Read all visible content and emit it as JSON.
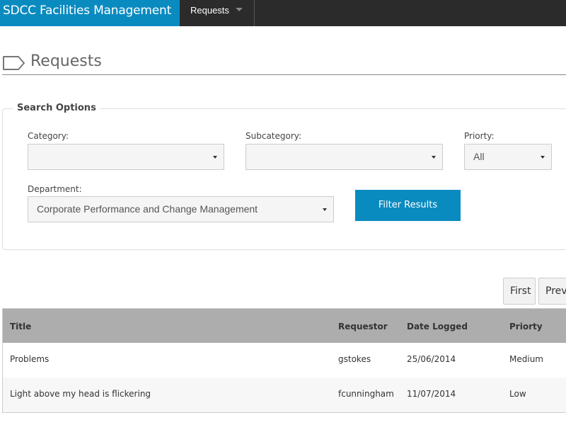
{
  "header": {
    "brand": "SDCC Facilities Management",
    "nav": [
      {
        "label": "Requests",
        "icon": "caret-down-icon"
      }
    ]
  },
  "page": {
    "title": "Requests",
    "title_icon": "tag-icon"
  },
  "search": {
    "legend": "Search Options",
    "category": {
      "label": "Category:",
      "value": ""
    },
    "subcategory": {
      "label": "Subcategory:",
      "value": ""
    },
    "priority": {
      "label": "Priorty:",
      "value": "All"
    },
    "department": {
      "label": "Department:",
      "value": "Corporate Performance and Change Management"
    },
    "filter_button": "Filter Results"
  },
  "pager": {
    "first": "First",
    "previous": "Previous"
  },
  "table": {
    "columns": [
      "Title",
      "Requestor",
      "Date Logged",
      "Priorty"
    ],
    "rows": [
      {
        "title": "Problems",
        "requestor": "gstokes",
        "date": "25/06/2014",
        "priority": "Medium"
      },
      {
        "title": "Light above my head is flickering",
        "requestor": "fcunningham",
        "date": "11/07/2014",
        "priority": "Low"
      }
    ]
  },
  "colors": {
    "brand": "#0a8bc0",
    "topbar": "#2b2b2b",
    "table_header": "#adadad"
  }
}
